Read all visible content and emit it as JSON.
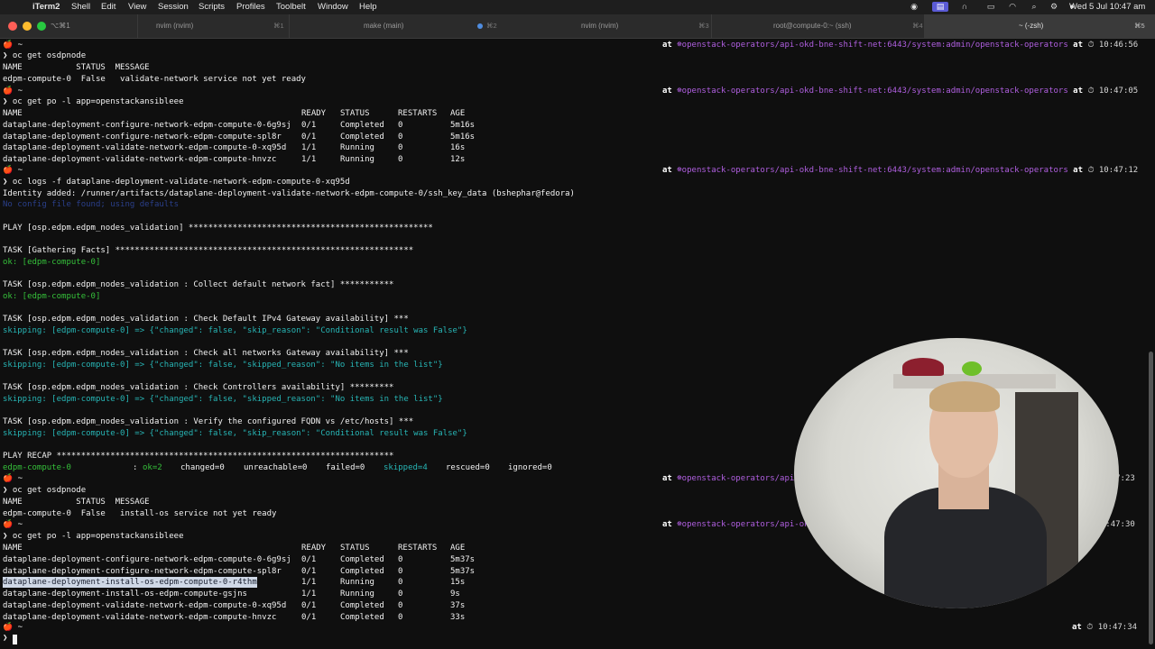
{
  "menubar": {
    "app": "iTerm2",
    "items": [
      "Shell",
      "Edit",
      "View",
      "Session",
      "Scripts",
      "Profiles",
      "Toolbelt",
      "Window",
      "Help"
    ],
    "datetime": "Wed 5 Jul  10:47 am"
  },
  "tabs": [
    {
      "label": "⌥⌘1",
      "shortcut": ""
    },
    {
      "label": "nvim (nvim)",
      "shortcut": "⌘1"
    },
    {
      "label": "make (main)",
      "shortcut": "⌘2"
    },
    {
      "label": "nvim (nvim)",
      "shortcut": "⌘3"
    },
    {
      "label": "root@compute-0:~ (ssh)",
      "shortcut": "⌘4"
    },
    {
      "label": "~ (-zsh)",
      "shortcut": "⌘5"
    }
  ],
  "prompt": {
    "glyph": "🍎 ~",
    "context_at": "at",
    "context": "☸openstack-operators/api-okd-bne-shift-net:6443/system:admin/openstack-operators",
    "context_short1": "☸openstack-operators/api-okd-bne-",
    "context_short2": "☸openstack-operators/api-okd-bne-sh"
  },
  "times": [
    "⏱ 10:46:56",
    "⏱ 10:47:05",
    "⏱ 10:47:12",
    "⏱ 10:47:23",
    "⏱ 10:47:30",
    "⏱ 10:47:34"
  ],
  "block1": {
    "cmd": "❯ oc get osdpnode",
    "header": "NAME           STATUS  MESSAGE",
    "row": "edpm-compute-0  False   validate-network service not yet ready"
  },
  "block2": {
    "cmd": "❯ oc get po -l app=openstackansibleee",
    "headers": {
      "name": "NAME",
      "ready": "READY",
      "status": "STATUS",
      "restarts": "RESTARTS",
      "age": "AGE"
    },
    "rows": [
      {
        "name": "dataplane-deployment-configure-network-edpm-compute-0-6g9sj",
        "ready": "0/1",
        "status": "Completed",
        "restarts": "0",
        "age": "5m16s"
      },
      {
        "name": "dataplane-deployment-configure-network-edpm-compute-spl8r",
        "ready": "0/1",
        "status": "Completed",
        "restarts": "0",
        "age": "5m16s"
      },
      {
        "name": "dataplane-deployment-validate-network-edpm-compute-0-xq95d",
        "ready": "1/1",
        "status": "Running",
        "restarts": "0",
        "age": "16s"
      },
      {
        "name": "dataplane-deployment-validate-network-edpm-compute-hnvzc",
        "ready": "1/1",
        "status": "Running",
        "restarts": "0",
        "age": "12s"
      }
    ]
  },
  "block3": {
    "cmd": "❯ oc logs -f dataplane-deployment-validate-network-edpm-compute-0-xq95d",
    "identity": "Identity added: /runner/artifacts/dataplane-deployment-validate-network-edpm-compute-0/ssh_key_data (bshephar@fedora)",
    "dim": "No config file found; using defaults",
    "play": "PLAY [osp.edpm.edpm_nodes_validation] **************************************************",
    "task1": "TASK [Gathering Facts] *************************************************************",
    "ok1": "ok: [edpm-compute-0]",
    "task2": "TASK [osp.edpm.edpm_nodes_validation : Collect default network fact] ***********",
    "ok2": "ok: [edpm-compute-0]",
    "task3": "TASK [osp.edpm.edpm_nodes_validation : Check Default IPv4 Gateway availability] ***",
    "skip3": "skipping: [edpm-compute-0] => {\"changed\": false, \"skip_reason\": \"Conditional result was False\"}",
    "task4": "TASK [osp.edpm.edpm_nodes_validation : Check all networks Gateway availability] ***",
    "skip4": "skipping: [edpm-compute-0] => {\"changed\": false, \"skipped_reason\": \"No items in the list\"}",
    "task5": "TASK [osp.edpm.edpm_nodes_validation : Check Controllers availability] *********",
    "skip5": "skipping: [edpm-compute-0] => {\"changed\": false, \"skipped_reason\": \"No items in the list\"}",
    "task6": "TASK [osp.edpm.edpm_nodes_validation : Verify the configured FQDN vs /etc/hosts] ***",
    "skip6": "skipping: [edpm-compute-0] => {\"changed\": false, \"skip_reason\": \"Conditional result was False\"}",
    "recap": "PLAY RECAP *********************************************************************",
    "recap_host": "edpm-compute-0",
    "recap_colon": ": ",
    "recap_ok": "ok=2",
    "recap_changed": "changed=0",
    "recap_unreachable": "unreachable=0",
    "recap_failed": "failed=0",
    "recap_skipped": "skipped=4",
    "recap_rescued": "rescued=0",
    "recap_ignored": "ignored=0"
  },
  "block4": {
    "cmd": "❯ oc get osdpnode",
    "header": "NAME           STATUS  MESSAGE",
    "row": "edpm-compute-0  False   install-os service not yet ready"
  },
  "block5": {
    "cmd": "❯ oc get po -l app=openstackansibleee",
    "headers": {
      "name": "NAME",
      "ready": "READY",
      "status": "STATUS",
      "restarts": "RESTARTS",
      "age": "AGE"
    },
    "rows": [
      {
        "name": "dataplane-deployment-configure-network-edpm-compute-0-6g9sj",
        "ready": "0/1",
        "status": "Completed",
        "restarts": "0",
        "age": "5m37s"
      },
      {
        "name": "dataplane-deployment-configure-network-edpm-compute-spl8r",
        "ready": "0/1",
        "status": "Completed",
        "restarts": "0",
        "age": "5m37s"
      },
      {
        "name": "dataplane-deployment-install-os-edpm-compute-0-r4thm",
        "ready": "1/1",
        "status": "Running",
        "restarts": "0",
        "age": "15s"
      },
      {
        "name": "dataplane-deployment-install-os-edpm-compute-gsjns",
        "ready": "1/1",
        "status": "Running",
        "restarts": "0",
        "age": "9s"
      },
      {
        "name": "dataplane-deployment-validate-network-edpm-compute-0-xq95d",
        "ready": "0/1",
        "status": "Completed",
        "restarts": "0",
        "age": "37s"
      },
      {
        "name": "dataplane-deployment-validate-network-edpm-compute-hnvzc",
        "ready": "0/1",
        "status": "Completed",
        "restarts": "0",
        "age": "33s"
      }
    ]
  },
  "final_prompt": "❯"
}
